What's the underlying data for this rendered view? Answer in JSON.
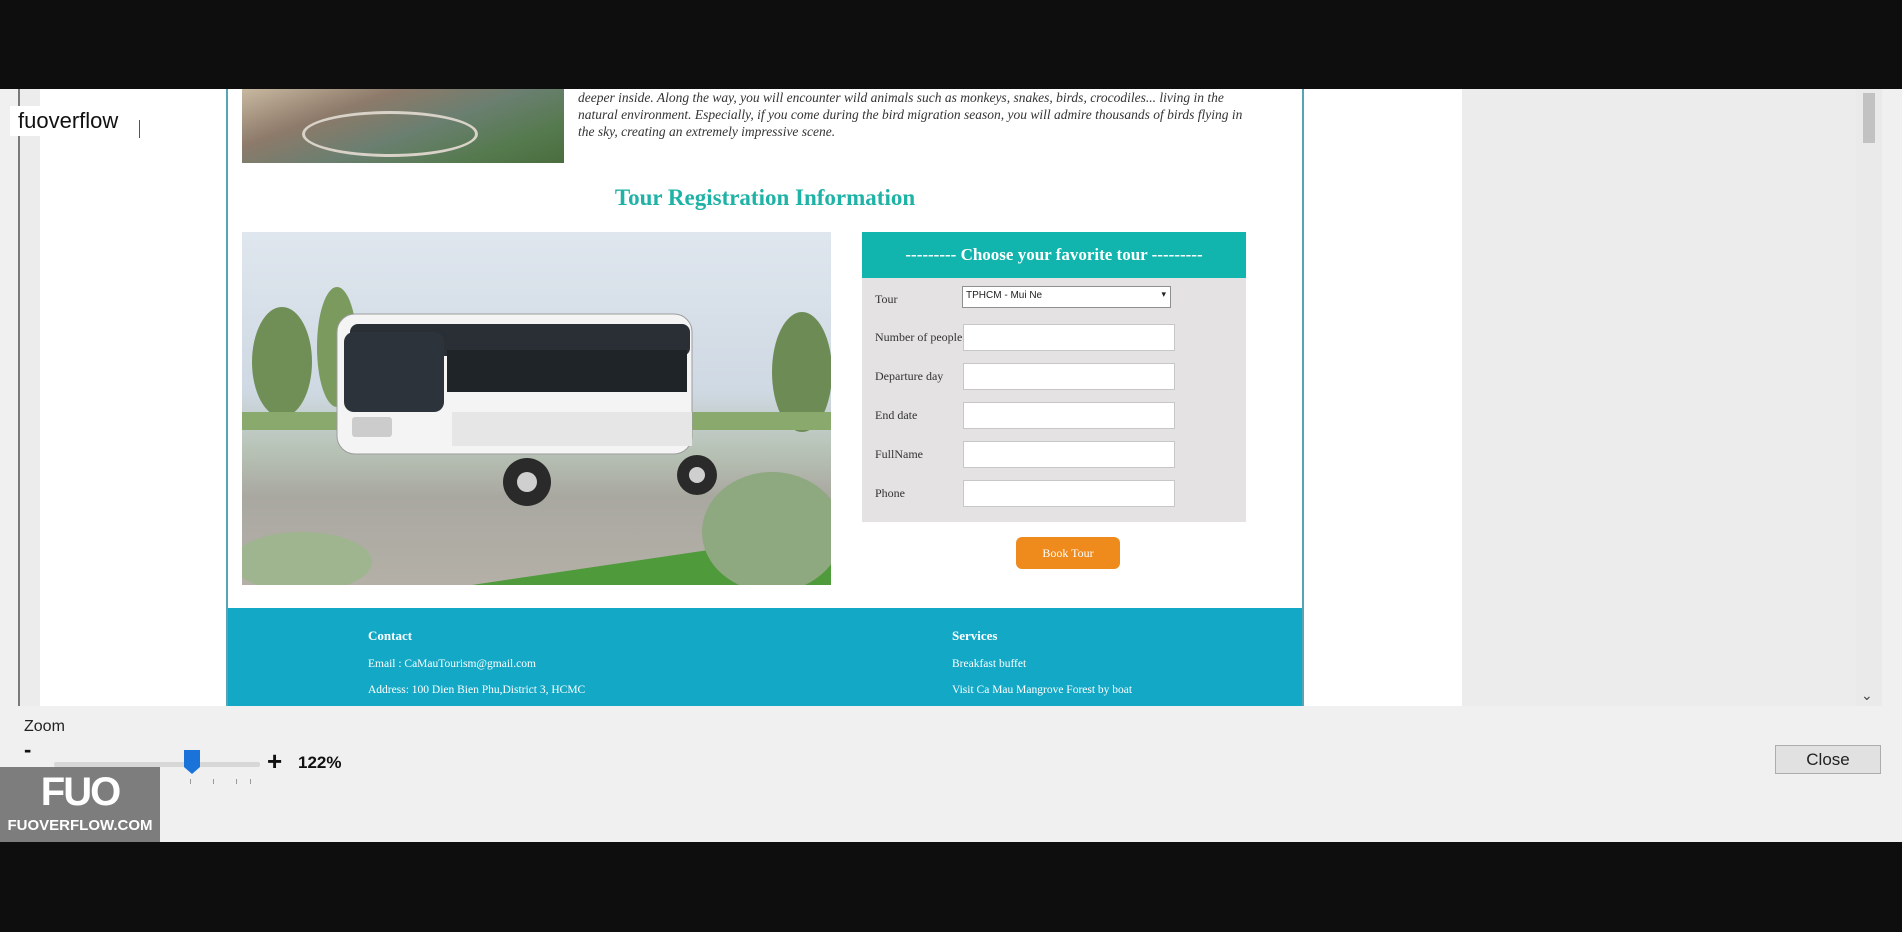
{
  "preview": {
    "top_text": [
      "deeper inside. Along the way, you will encounter wild animals such as monkeys, snakes, birds, crocodiles... living in the",
      "natural environment. Especially, if you come during the bird migration season, you will admire thousands of birds flying in",
      "the sky, creating an extremely impressive scene."
    ],
    "section_title": "Tour Registration Information",
    "form": {
      "header": "--------- Choose your favorite tour ---------",
      "tour_label": "Tour",
      "tour_value": "TPHCM - Mui Ne",
      "people_label": "Number of people",
      "departure_label": "Departure day",
      "end_label": "End date",
      "fullname_label": "FullName",
      "phone_label": "Phone",
      "book_button": "Book Tour"
    },
    "footer": {
      "contact_title": "Contact",
      "email": "Email : CaMauTourism@gmail.com",
      "address": "Address: 100 Dien Bien Phu,District 3, HCMC",
      "services_title": "Services",
      "service_1": "Breakfast buffet",
      "service_2": "Visit Ca Mau Mangrove Forest by boat"
    }
  },
  "watermark_text": "fuoverflow",
  "zoom": {
    "label": "Zoom",
    "minus": "-",
    "plus": "+",
    "value": "122%",
    "level_fraction": 0.67
  },
  "close_button": "Close",
  "logo": {
    "mark": "FUO",
    "url": "FUOVERFLOW.COM"
  },
  "colors": {
    "accent_teal": "#12b5ad",
    "footer_blue": "#13a8c6",
    "book_orange": "#ef8a1c",
    "slider_blue": "#1a73d9"
  }
}
